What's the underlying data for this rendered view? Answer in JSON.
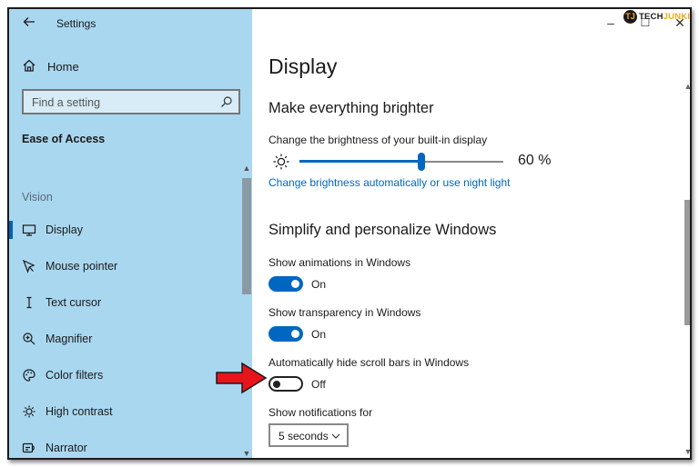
{
  "window": {
    "title": "Settings",
    "minimize": "–",
    "maximize": "☐",
    "close": "✕"
  },
  "watermark": {
    "mark": "TJ",
    "part1": "TECH",
    "part2": "JUNKIE"
  },
  "sidebar": {
    "home_label": "Home",
    "search_placeholder": "Find a setting",
    "section": "Ease of Access",
    "group": "Vision",
    "items": [
      {
        "label": "Display",
        "icon": "monitor-icon",
        "selected": true
      },
      {
        "label": "Mouse pointer",
        "icon": "mouse-pointer-icon",
        "selected": false
      },
      {
        "label": "Text cursor",
        "icon": "text-cursor-icon",
        "selected": false
      },
      {
        "label": "Magnifier",
        "icon": "magnifier-icon",
        "selected": false
      },
      {
        "label": "Color filters",
        "icon": "color-filters-icon",
        "selected": false
      },
      {
        "label": "High contrast",
        "icon": "high-contrast-icon",
        "selected": false
      },
      {
        "label": "Narrator",
        "icon": "narrator-icon",
        "selected": false
      }
    ]
  },
  "main": {
    "title": "Display",
    "brighter_heading": "Make everything brighter",
    "brightness_label": "Change the brightness of your built-in display",
    "brightness_fraction": 0.6,
    "brightness_value": "60 %",
    "brightness_link": "Change brightness automatically or use night light",
    "simplify_heading": "Simplify and personalize Windows",
    "animations_label": "Show animations in Windows",
    "animations_state": "On",
    "transparency_label": "Show transparency in Windows",
    "transparency_state": "On",
    "scrollbars_label": "Automatically hide scroll bars in Windows",
    "scrollbars_state": "Off",
    "notifications_label": "Show notifications for",
    "notifications_value": "5 seconds"
  },
  "colors": {
    "accent": "#0067c0",
    "sidebar_bg": "#a9d7f0",
    "annotation_arrow": "#e8141c"
  }
}
